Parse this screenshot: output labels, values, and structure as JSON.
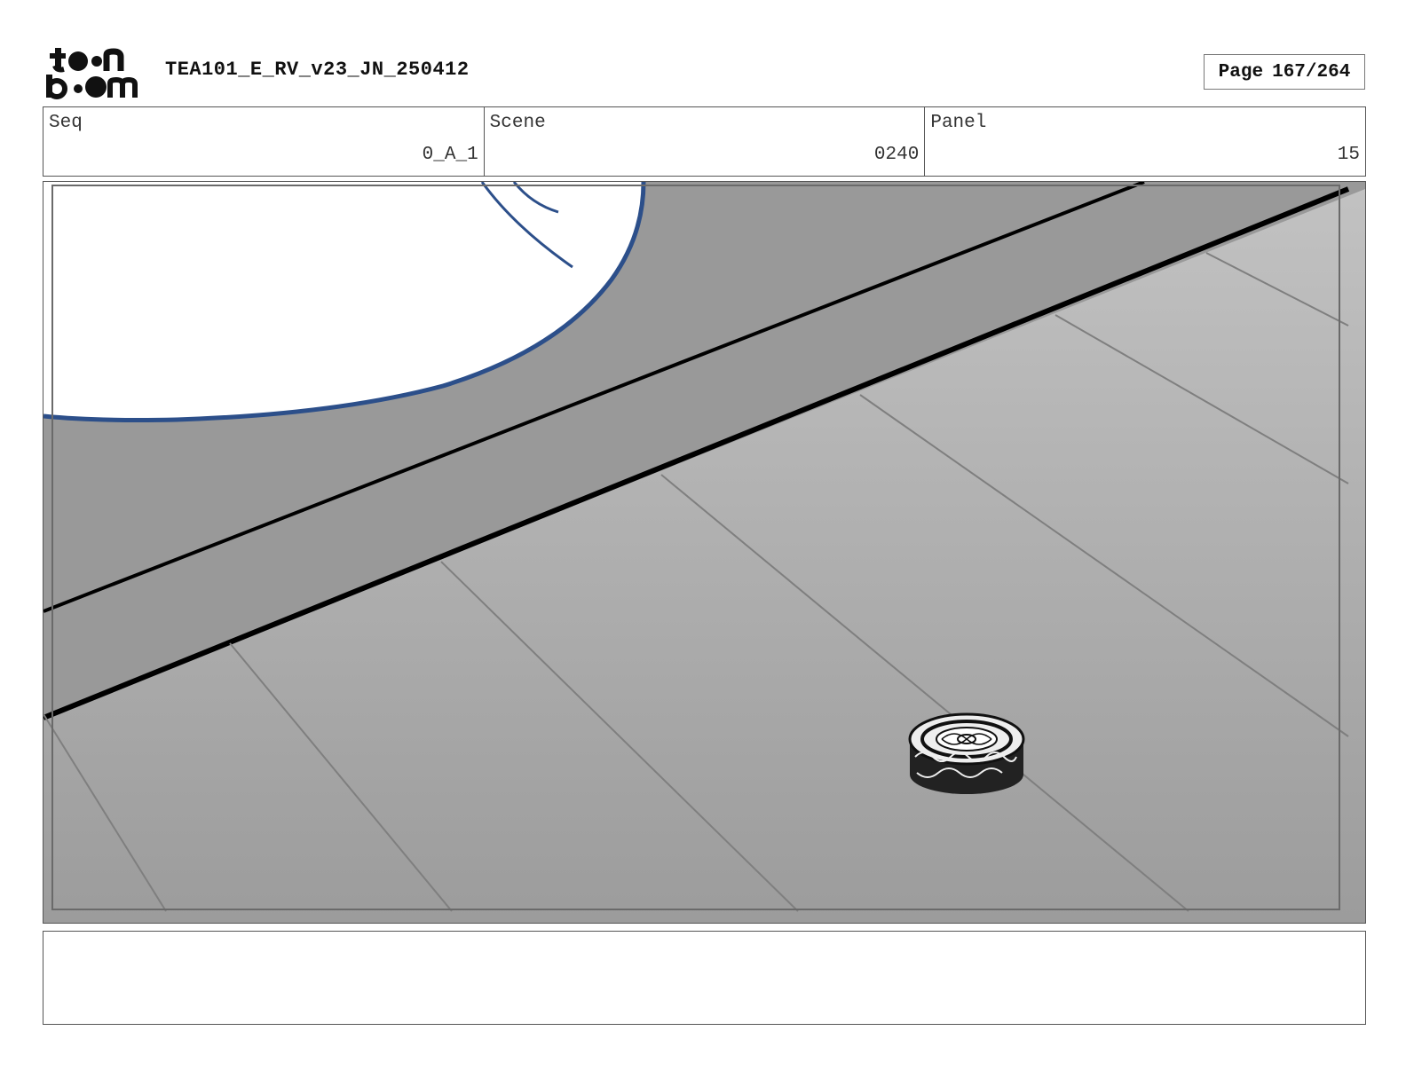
{
  "header": {
    "logo_text_top": "toon",
    "logo_text_bottom": "boom",
    "title": "TEA101_E_RV_v23_JN_250412",
    "page_label": "Page",
    "page_number": "167/264"
  },
  "info": {
    "seq_label": "Seq",
    "seq_value": "0_A_1",
    "scene_label": "Scene",
    "scene_value": "0240",
    "panel_label": "Panel",
    "panel_value": "15"
  },
  "panel": {
    "description_icon": "storyboard-drawing",
    "colors": {
      "floor_light": "#b9b9b9",
      "floor_dark": "#9e9e9e",
      "baseboard": "#999999",
      "stroke_blue": "#2c4f8a",
      "ink": "#000000"
    }
  },
  "notes": {
    "text": ""
  }
}
